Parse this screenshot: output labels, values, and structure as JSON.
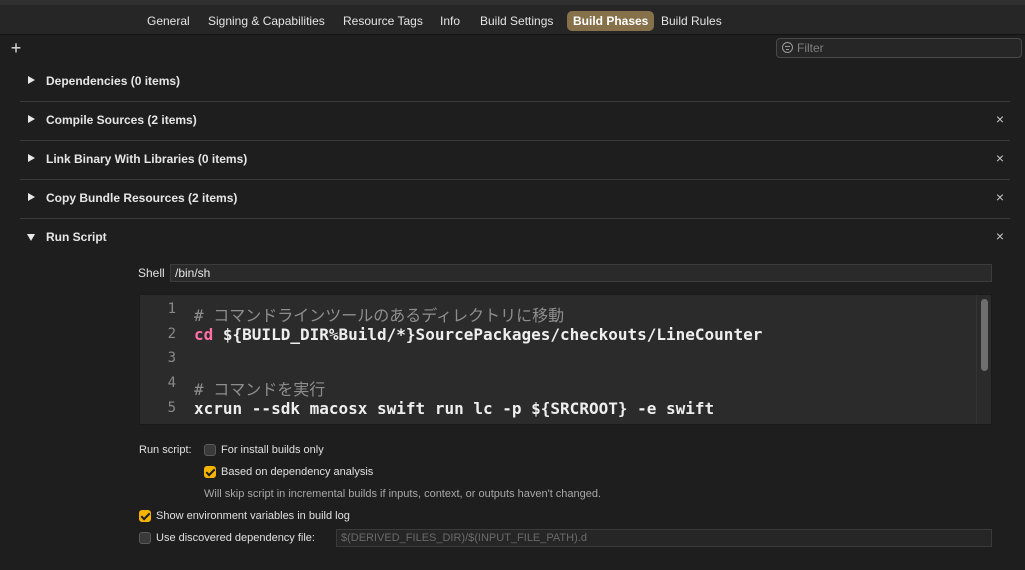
{
  "tabs": [
    {
      "label": "General",
      "active": false
    },
    {
      "label": "Signing & Capabilities",
      "active": false
    },
    {
      "label": "Resource Tags",
      "active": false
    },
    {
      "label": "Info",
      "active": false
    },
    {
      "label": "Build Settings",
      "active": false
    },
    {
      "label": "Build Phases",
      "active": true
    },
    {
      "label": "Build Rules",
      "active": false
    }
  ],
  "toolbar": {
    "add_icon": "plus-icon",
    "filter_placeholder": "Filter",
    "filter_icon": "filter-icon"
  },
  "sections": [
    {
      "title": "Dependencies (0 items)",
      "expanded": false,
      "removable": false
    },
    {
      "title": "Compile Sources (2 items)",
      "expanded": false,
      "removable": true
    },
    {
      "title": "Link Binary With Libraries (0 items)",
      "expanded": false,
      "removable": true
    },
    {
      "title": "Copy Bundle Resources (2 items)",
      "expanded": false,
      "removable": true
    },
    {
      "title": "Run Script",
      "expanded": true,
      "removable": true
    }
  ],
  "run_script": {
    "shell_label": "Shell",
    "shell_value": "/bin/sh",
    "code_lines": [
      {
        "num": "1",
        "text": "# コマンドラインツールのあるディレクトリに移動"
      },
      {
        "num": "2",
        "keyword": "cd",
        "text": " ${BUILD_DIR%Build/*}SourcePackages/checkouts/LineCounter"
      },
      {
        "num": "3",
        "text": ""
      },
      {
        "num": "4",
        "text": "# コマンドを実行"
      },
      {
        "num": "5",
        "text": "xcrun --sdk macosx swift run lc -p ${SRCROOT} -e swift"
      }
    ],
    "run_script_label": "Run script:",
    "install_builds_label": "For install builds only",
    "install_builds_checked": false,
    "dependency_analysis_label": "Based on dependency analysis",
    "dependency_analysis_checked": true,
    "dependency_hint": "Will skip script in incremental builds if inputs, context, or outputs haven't changed.",
    "show_env_label": "Show environment variables in build log",
    "show_env_checked": true,
    "discovered_dep_label": "Use discovered dependency file:",
    "discovered_dep_checked": false,
    "discovered_dep_placeholder": "$(DERIVED_FILES_DIR)/$(INPUT_FILE_PATH).d"
  },
  "colors": {
    "accent_tab": "#86714a",
    "checkbox_checked": "#f4b400",
    "keyword": "#ff6fa6",
    "comment": "#8e8e8e"
  }
}
